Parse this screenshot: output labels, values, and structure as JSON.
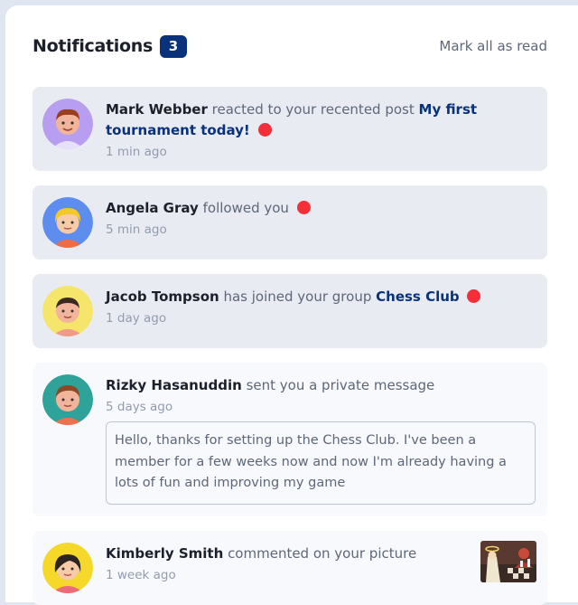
{
  "header": {
    "title": "Notifications",
    "unread_count": "3",
    "mark_all_label": "Mark all as read"
  },
  "notifications": [
    {
      "name": "Mark Webber",
      "action": "reacted to your recented post",
      "target": "My first tournament today!",
      "time": "1 min ago",
      "unread": true
    },
    {
      "name": "Angela Gray",
      "action": "followed you",
      "time": "5 min ago",
      "unread": true
    },
    {
      "name": "Jacob Tompson",
      "action": "has joined your group",
      "group": "Chess Club",
      "time": "1 day ago",
      "unread": true
    },
    {
      "name": "Rizky Hasanuddin",
      "action": "sent you a private message",
      "time": "5 days ago",
      "message": "Hello, thanks for setting up the Chess Club. I've been a member for a few weeks now and now I'm already having a lots of fun and improving my game",
      "unread": false
    },
    {
      "name": "Kimberly Smith",
      "action": "commented on your picture",
      "time": "1 week ago",
      "unread": false
    }
  ],
  "colors": {
    "unread_dot": "#f62e38",
    "badge": "#0a327b",
    "unread_bg": "#e8ebf2",
    "read_bg": "#f7f9fc"
  }
}
